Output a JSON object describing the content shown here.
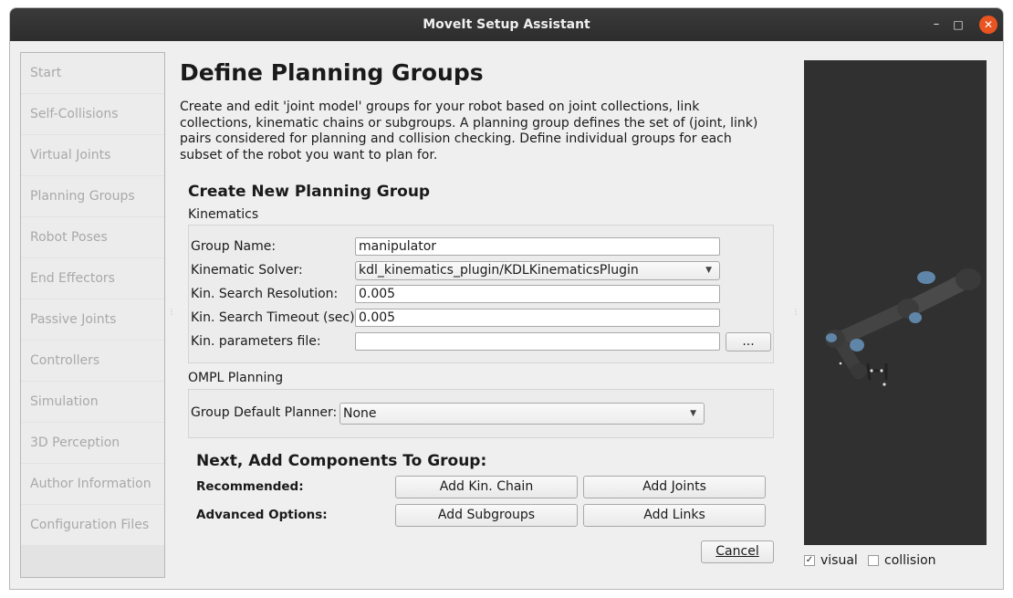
{
  "window": {
    "title": "MoveIt Setup Assistant",
    "controls": {
      "minimize": "–",
      "maximize": "□",
      "close": "✕"
    }
  },
  "sidebar": {
    "items": [
      {
        "label": "Start"
      },
      {
        "label": "Self-Collisions"
      },
      {
        "label": "Virtual Joints"
      },
      {
        "label": "Planning Groups"
      },
      {
        "label": "Robot Poses"
      },
      {
        "label": "End Effectors"
      },
      {
        "label": "Passive Joints"
      },
      {
        "label": "Controllers"
      },
      {
        "label": "Simulation"
      },
      {
        "label": "3D Perception"
      },
      {
        "label": "Author Information"
      },
      {
        "label": "Configuration Files"
      }
    ]
  },
  "main": {
    "title": "Define Planning Groups",
    "description": "Create and edit 'joint model' groups for your robot based on joint collections, link collections, kinematic chains or subgroups. A planning group defines the set of (joint, link) pairs considered for planning and collision checking. Define individual groups for each subset of the robot you want to plan for.",
    "create_heading": "Create New Planning Group",
    "kinematics": {
      "section_label": "Kinematics",
      "group_name_label": "Group Name:",
      "group_name_value": "manipulator",
      "solver_label": "Kinematic Solver:",
      "solver_value": "kdl_kinematics_plugin/KDLKinematicsPlugin",
      "resolution_label": "Kin. Search Resolution:",
      "resolution_value": "0.005",
      "timeout_label": "Kin. Search Timeout (sec):",
      "timeout_value": "0.005",
      "params_label": "Kin. parameters file:",
      "params_value": "",
      "browse_label": "..."
    },
    "ompl": {
      "section_label": "OMPL Planning",
      "planner_label": "Group Default Planner:",
      "planner_value": "None"
    },
    "components": {
      "heading": "Next, Add Components To Group:",
      "recommended_label": "Recommended:",
      "advanced_label": "Advanced Options:",
      "add_chain": "Add Kin. Chain",
      "add_joints": "Add Joints",
      "add_subgroups": "Add Subgroups",
      "add_links": "Add Links"
    },
    "cancel_label": "Cancel"
  },
  "viewer": {
    "visual_label": "visual",
    "visual_checked": true,
    "collision_label": "collision",
    "collision_checked": false,
    "colors": {
      "background": "#303030",
      "link": "#4a4a4a",
      "joint_cap": "#5f86a8"
    }
  }
}
